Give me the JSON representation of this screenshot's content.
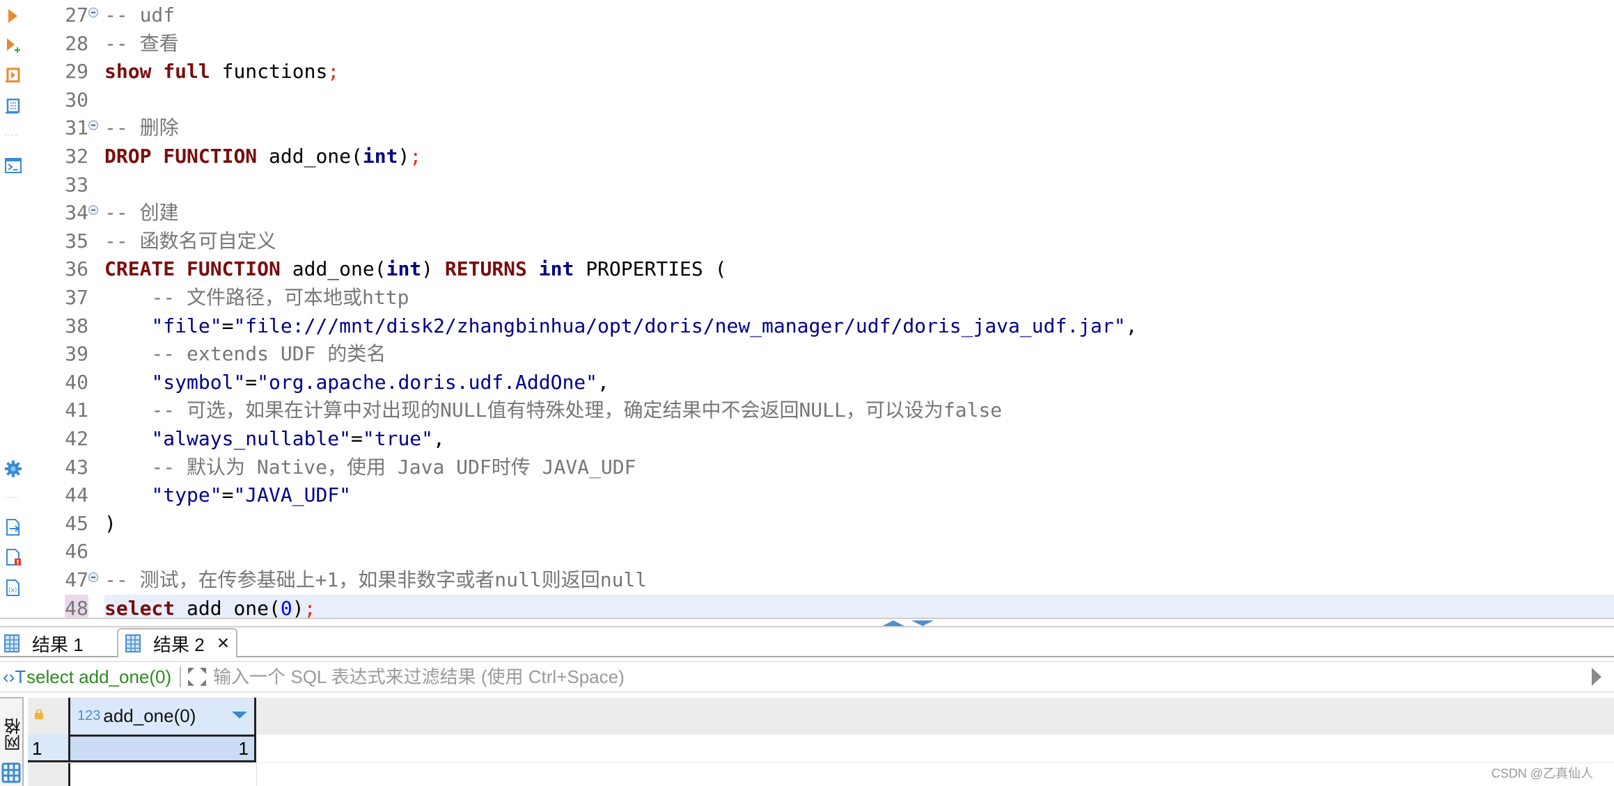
{
  "editor": {
    "lines": [
      {
        "n": "27",
        "fold": true,
        "tokens": [
          {
            "t": "cm",
            "v": "-- udf"
          }
        ]
      },
      {
        "n": "28",
        "fold": false,
        "tokens": [
          {
            "t": "cm",
            "v": "-- 查看"
          }
        ]
      },
      {
        "n": "29",
        "fold": false,
        "tokens": [
          {
            "t": "kw",
            "v": "show"
          },
          {
            "t": "",
            "v": " "
          },
          {
            "t": "kw",
            "v": "full"
          },
          {
            "t": "",
            "v": " functions"
          },
          {
            "t": "punct",
            "v": ";"
          }
        ]
      },
      {
        "n": "30",
        "fold": false,
        "tokens": []
      },
      {
        "n": "31",
        "fold": true,
        "tokens": [
          {
            "t": "cm",
            "v": "-- 删除"
          }
        ]
      },
      {
        "n": "32",
        "fold": false,
        "tokens": [
          {
            "t": "kw",
            "v": "DROP"
          },
          {
            "t": "",
            "v": " "
          },
          {
            "t": "kw",
            "v": "FUNCTION"
          },
          {
            "t": "",
            "v": " add_one("
          },
          {
            "t": "ty",
            "v": "int"
          },
          {
            "t": "",
            "v": ")"
          },
          {
            "t": "punct",
            "v": ";"
          }
        ]
      },
      {
        "n": "33",
        "fold": false,
        "tokens": []
      },
      {
        "n": "34",
        "fold": true,
        "tokens": [
          {
            "t": "cm",
            "v": "-- 创建"
          }
        ]
      },
      {
        "n": "35",
        "fold": false,
        "tokens": [
          {
            "t": "cm",
            "v": "-- 函数名可自定义"
          }
        ]
      },
      {
        "n": "36",
        "fold": false,
        "tokens": [
          {
            "t": "kw",
            "v": "CREATE"
          },
          {
            "t": "",
            "v": " "
          },
          {
            "t": "kw",
            "v": "FUNCTION"
          },
          {
            "t": "",
            "v": " add_one("
          },
          {
            "t": "ty",
            "v": "int"
          },
          {
            "t": "",
            "v": ") "
          },
          {
            "t": "kw",
            "v": "RETURNS"
          },
          {
            "t": "",
            "v": " "
          },
          {
            "t": "ty",
            "v": "int"
          },
          {
            "t": "",
            "v": " PROPERTIES ("
          }
        ]
      },
      {
        "n": "37",
        "fold": false,
        "tokens": [
          {
            "t": "",
            "v": "    "
          },
          {
            "t": "cm",
            "v": "-- 文件路径，可本地或http"
          }
        ]
      },
      {
        "n": "38",
        "fold": false,
        "tokens": [
          {
            "t": "",
            "v": "    "
          },
          {
            "t": "str",
            "v": "\"file\""
          },
          {
            "t": "",
            "v": "="
          },
          {
            "t": "str",
            "v": "\"file:///mnt/disk2/zhangbinhua/opt/doris/new_manager/udf/doris_java_udf.jar\""
          },
          {
            "t": "",
            "v": ","
          }
        ]
      },
      {
        "n": "39",
        "fold": false,
        "tokens": [
          {
            "t": "",
            "v": "    "
          },
          {
            "t": "cm",
            "v": "-- extends UDF 的类名"
          }
        ]
      },
      {
        "n": "40",
        "fold": false,
        "tokens": [
          {
            "t": "",
            "v": "    "
          },
          {
            "t": "str",
            "v": "\"symbol\""
          },
          {
            "t": "",
            "v": "="
          },
          {
            "t": "str",
            "v": "\"org.apache.doris.udf.AddOne\""
          },
          {
            "t": "",
            "v": ","
          }
        ]
      },
      {
        "n": "41",
        "fold": false,
        "tokens": [
          {
            "t": "",
            "v": "    "
          },
          {
            "t": "cm",
            "v": "-- 可选，如果在计算中对出现的NULL值有特殊处理，确定结果中不会返回NULL，可以设为false"
          }
        ]
      },
      {
        "n": "42",
        "fold": false,
        "tokens": [
          {
            "t": "",
            "v": "    "
          },
          {
            "t": "str",
            "v": "\"always_nullable\""
          },
          {
            "t": "",
            "v": "="
          },
          {
            "t": "str",
            "v": "\"true\""
          },
          {
            "t": "",
            "v": ","
          }
        ]
      },
      {
        "n": "43",
        "fold": false,
        "tokens": [
          {
            "t": "",
            "v": "    "
          },
          {
            "t": "cm",
            "v": "-- 默认为 Native，使用 Java UDF时传 JAVA_UDF"
          }
        ]
      },
      {
        "n": "44",
        "fold": false,
        "tokens": [
          {
            "t": "",
            "v": "    "
          },
          {
            "t": "str",
            "v": "\"type\""
          },
          {
            "t": "",
            "v": "="
          },
          {
            "t": "str",
            "v": "\"JAVA_UDF\""
          }
        ]
      },
      {
        "n": "45",
        "fold": false,
        "tokens": [
          {
            "t": "",
            "v": ")"
          }
        ]
      },
      {
        "n": "46",
        "fold": false,
        "tokens": []
      },
      {
        "n": "47",
        "fold": true,
        "tokens": [
          {
            "t": "cm",
            "v": "-- 测试，在传参基础上+1，如果非数字或者null则返回null"
          }
        ]
      },
      {
        "n": "48",
        "fold": false,
        "current": true,
        "tokens": [
          {
            "t": "kw",
            "v": "select"
          },
          {
            "t": "",
            "v": " add_one("
          },
          {
            "t": "num",
            "v": "0"
          },
          {
            "t": "",
            "v": ")"
          },
          {
            "t": "punct",
            "v": ";"
          }
        ]
      }
    ]
  },
  "side_toolbar": {
    "icons": [
      "execute-statement-icon",
      "execute-in-new-tab-icon",
      "execute-script-icon",
      "execute-script-new-tab-icon",
      "more-dots",
      "console-icon",
      "settings-gear-icon",
      "more-dots",
      "export-icon",
      "problems-icon",
      "variables-icon"
    ]
  },
  "results": {
    "tabs": [
      {
        "label": "结果 1",
        "active": false
      },
      {
        "label": "结果 2",
        "active": true,
        "closable": true
      }
    ],
    "filter": {
      "query": "select add_one(0)",
      "placeholder": "输入一个 SQL 表达式来过滤结果 (使用 Ctrl+Space)",
      "value": ""
    },
    "grid": {
      "side_tab_label": "网格",
      "columns": [
        {
          "type_badge": "123",
          "name": "add_one(0)"
        }
      ],
      "rows": [
        {
          "num": "1",
          "cells": [
            "1"
          ]
        }
      ]
    }
  },
  "watermark": "CSDN @乙真仙人",
  "colors": {
    "keyword": "#7a0d0d",
    "type": "#000080",
    "string": "#00008b",
    "comment": "#777777",
    "accent_blue": "#4a8fd0",
    "run_orange": "#e98b2f",
    "filter_green": "#2e8b22",
    "current_line": "#e8eefa"
  }
}
